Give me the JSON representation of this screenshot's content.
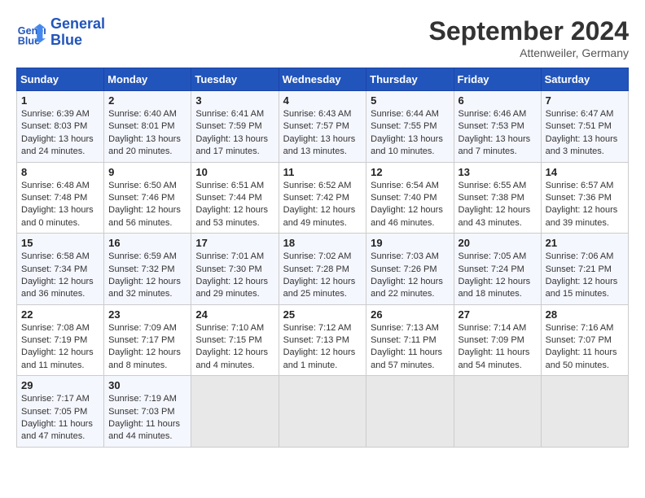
{
  "header": {
    "logo_line1": "General",
    "logo_line2": "Blue",
    "month": "September 2024",
    "location": "Attenweiler, Germany"
  },
  "weekdays": [
    "Sunday",
    "Monday",
    "Tuesday",
    "Wednesday",
    "Thursday",
    "Friday",
    "Saturday"
  ],
  "weeks": [
    [
      {
        "day": "1",
        "sunrise": "6:39 AM",
        "sunset": "8:03 PM",
        "daylight": "13 hours and 24 minutes."
      },
      {
        "day": "2",
        "sunrise": "6:40 AM",
        "sunset": "8:01 PM",
        "daylight": "13 hours and 20 minutes."
      },
      {
        "day": "3",
        "sunrise": "6:41 AM",
        "sunset": "7:59 PM",
        "daylight": "13 hours and 17 minutes."
      },
      {
        "day": "4",
        "sunrise": "6:43 AM",
        "sunset": "7:57 PM",
        "daylight": "13 hours and 13 minutes."
      },
      {
        "day": "5",
        "sunrise": "6:44 AM",
        "sunset": "7:55 PM",
        "daylight": "13 hours and 10 minutes."
      },
      {
        "day": "6",
        "sunrise": "6:46 AM",
        "sunset": "7:53 PM",
        "daylight": "13 hours and 7 minutes."
      },
      {
        "day": "7",
        "sunrise": "6:47 AM",
        "sunset": "7:51 PM",
        "daylight": "13 hours and 3 minutes."
      }
    ],
    [
      {
        "day": "8",
        "sunrise": "6:48 AM",
        "sunset": "7:48 PM",
        "daylight": "13 hours and 0 minutes."
      },
      {
        "day": "9",
        "sunrise": "6:50 AM",
        "sunset": "7:46 PM",
        "daylight": "12 hours and 56 minutes."
      },
      {
        "day": "10",
        "sunrise": "6:51 AM",
        "sunset": "7:44 PM",
        "daylight": "12 hours and 53 minutes."
      },
      {
        "day": "11",
        "sunrise": "6:52 AM",
        "sunset": "7:42 PM",
        "daylight": "12 hours and 49 minutes."
      },
      {
        "day": "12",
        "sunrise": "6:54 AM",
        "sunset": "7:40 PM",
        "daylight": "12 hours and 46 minutes."
      },
      {
        "day": "13",
        "sunrise": "6:55 AM",
        "sunset": "7:38 PM",
        "daylight": "12 hours and 43 minutes."
      },
      {
        "day": "14",
        "sunrise": "6:57 AM",
        "sunset": "7:36 PM",
        "daylight": "12 hours and 39 minutes."
      }
    ],
    [
      {
        "day": "15",
        "sunrise": "6:58 AM",
        "sunset": "7:34 PM",
        "daylight": "12 hours and 36 minutes."
      },
      {
        "day": "16",
        "sunrise": "6:59 AM",
        "sunset": "7:32 PM",
        "daylight": "12 hours and 32 minutes."
      },
      {
        "day": "17",
        "sunrise": "7:01 AM",
        "sunset": "7:30 PM",
        "daylight": "12 hours and 29 minutes."
      },
      {
        "day": "18",
        "sunrise": "7:02 AM",
        "sunset": "7:28 PM",
        "daylight": "12 hours and 25 minutes."
      },
      {
        "day": "19",
        "sunrise": "7:03 AM",
        "sunset": "7:26 PM",
        "daylight": "12 hours and 22 minutes."
      },
      {
        "day": "20",
        "sunrise": "7:05 AM",
        "sunset": "7:24 PM",
        "daylight": "12 hours and 18 minutes."
      },
      {
        "day": "21",
        "sunrise": "7:06 AM",
        "sunset": "7:21 PM",
        "daylight": "12 hours and 15 minutes."
      }
    ],
    [
      {
        "day": "22",
        "sunrise": "7:08 AM",
        "sunset": "7:19 PM",
        "daylight": "12 hours and 11 minutes."
      },
      {
        "day": "23",
        "sunrise": "7:09 AM",
        "sunset": "7:17 PM",
        "daylight": "12 hours and 8 minutes."
      },
      {
        "day": "24",
        "sunrise": "7:10 AM",
        "sunset": "7:15 PM",
        "daylight": "12 hours and 4 minutes."
      },
      {
        "day": "25",
        "sunrise": "7:12 AM",
        "sunset": "7:13 PM",
        "daylight": "12 hours and 1 minute."
      },
      {
        "day": "26",
        "sunrise": "7:13 AM",
        "sunset": "7:11 PM",
        "daylight": "11 hours and 57 minutes."
      },
      {
        "day": "27",
        "sunrise": "7:14 AM",
        "sunset": "7:09 PM",
        "daylight": "11 hours and 54 minutes."
      },
      {
        "day": "28",
        "sunrise": "7:16 AM",
        "sunset": "7:07 PM",
        "daylight": "11 hours and 50 minutes."
      }
    ],
    [
      {
        "day": "29",
        "sunrise": "7:17 AM",
        "sunset": "7:05 PM",
        "daylight": "11 hours and 47 minutes."
      },
      {
        "day": "30",
        "sunrise": "7:19 AM",
        "sunset": "7:03 PM",
        "daylight": "11 hours and 44 minutes."
      },
      null,
      null,
      null,
      null,
      null
    ]
  ]
}
